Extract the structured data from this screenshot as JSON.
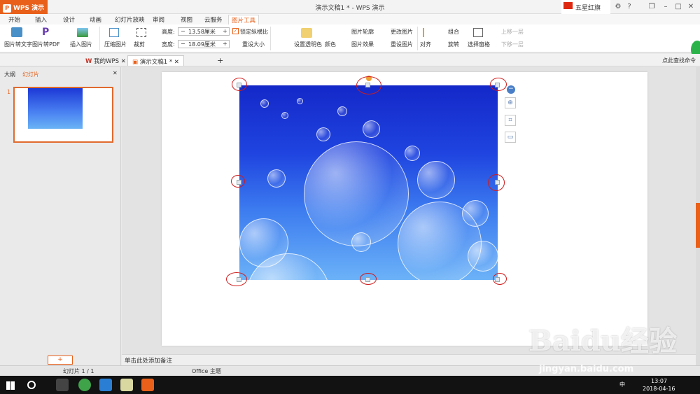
{
  "titlebar": {
    "app_name": "WPS 演示",
    "doc_title": "演示文稿1 * - WPS 演示",
    "user_name": "五星红旗",
    "icons": [
      "settings-icon",
      "help-icon",
      "minimize-icon",
      "restore-icon",
      "close-icon"
    ],
    "help_text": "?"
  },
  "tabs": [
    "开始",
    "插入",
    "设计",
    "动画",
    "幻灯片放映",
    "审阅",
    "视图",
    "云服务",
    "图片工具"
  ],
  "ribbon": {
    "pic_to_text": "图片转文字",
    "pic_to_pdf": "图片转PDF",
    "insert_picture": "插入图片",
    "compress_picture": "压缩图片",
    "crop": "裁剪",
    "height_label": "高度:",
    "height_value": "13.58厘米",
    "width_label": "宽度:",
    "width_value": "18.09厘米",
    "lock_ratio": "锁定纵横比",
    "reset_size": "重设大小",
    "set_transparent": "设置透明色",
    "color": "颜色",
    "picture_outline": "图片轮廓",
    "picture_effect": "图片效果",
    "change_picture": "更改图片",
    "reset_picture": "重设图片",
    "align": "对齐",
    "group": "组合",
    "rotate": "旋转",
    "selection_pane": "选择窗格",
    "bring_forward": "上移一层",
    "send_backward": "下移一层",
    "minus": "−",
    "plus": "+"
  },
  "doctabs": {
    "my_wps": "我的WPS",
    "doc": "演示文稿1 *",
    "search_hint": "点此查找命令",
    "add": "+"
  },
  "leftpanel": {
    "tab_outline": "大纲",
    "tab_slides": "幻灯片",
    "slide_number": "1",
    "add_slide": "+"
  },
  "notes_placeholder": "单击此处添加备注",
  "status": {
    "slide_info": "幻灯片 1 / 1",
    "theme": "Office 主题"
  },
  "taskbar": {
    "time": "13:07",
    "date": "2018-04-16",
    "ime": "中"
  },
  "watermark": {
    "brand": "Baidu经验",
    "url": "jingyan.baidu.com"
  },
  "colors": {
    "accent": "#e8601a",
    "annotation_red": "#d01c1c"
  }
}
